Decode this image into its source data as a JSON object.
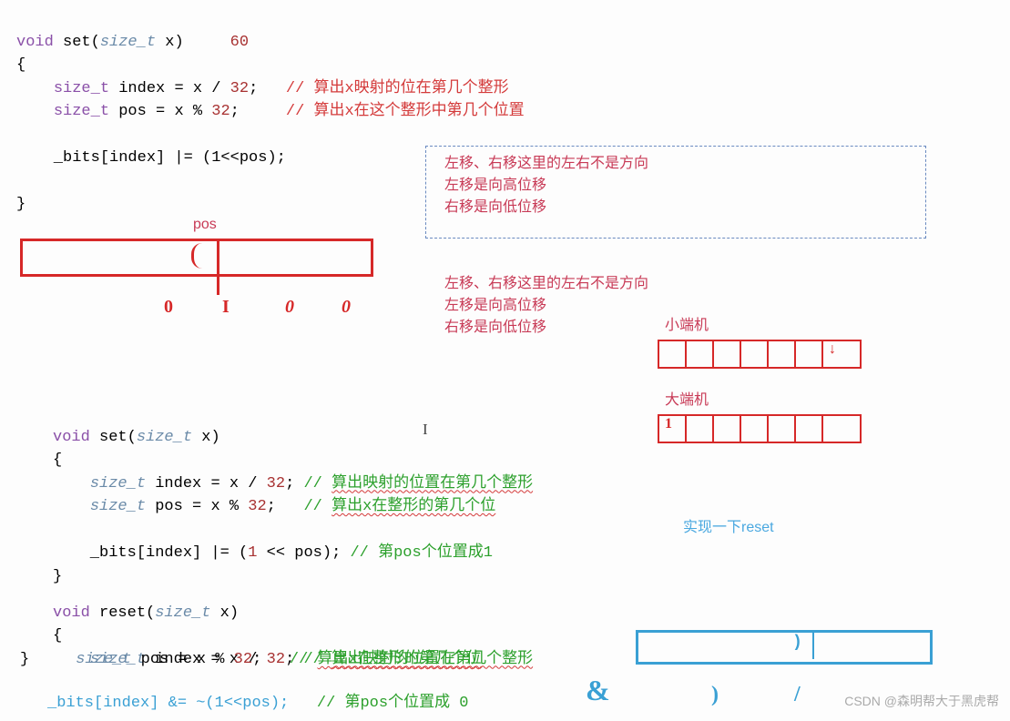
{
  "code1": {
    "l1a": "void",
    "l1b": " set(",
    "l1c": "size_t",
    "l1d": " x)",
    "anno60": "60",
    "l2": "{",
    "l3a": "    ",
    "l3b": "size_t",
    "l3c": " index = x / ",
    "l3d": "32",
    "l3e": ";   ",
    "l3f": "// 算出x映射的位在第几个整形",
    "l4a": "    ",
    "l4b": "size_t",
    "l4c": " pos = x % ",
    "l4d": "32",
    "l4e": ";     ",
    "l4f": "// 算出x在这个整形中第几个位置",
    "l6": "    _bits[index] |= (1<<pos);",
    "l8": "}",
    "poslabel": "pos"
  },
  "box1": {
    "l1": "左移、右移这里的左右不是方向",
    "l2": "左移是向高位移",
    "l3": "右移是向低位移"
  },
  "box2": {
    "l1": "左移、右移这里的左右不是方向",
    "l2": "左移是向高位移",
    "l3": "右移是向低位移"
  },
  "endian": {
    "little": "小端机",
    "big": "大端机"
  },
  "hint": "实现一下reset",
  "code2": {
    "l1a": "void",
    "l1b": " set(",
    "l1c": "size_t",
    "l1d": " x)",
    "l2": "{",
    "l3a": "    ",
    "l3b": "size_t",
    "l3c": " index = x / ",
    "l3d": "32",
    "l3e": "; ",
    "l3f": "// ",
    "l3g": "算出映射的位置在第几个整形",
    "l4a": "    ",
    "l4b": "size_t",
    "l4c": " pos = x % ",
    "l4d": "32",
    "l4e": ";   ",
    "l4f": "// ",
    "l4g": "算出x在整形的第几个位",
    "l6a": "    _bits[index] |= (",
    "l6b": "1",
    "l6c": " << pos); ",
    "l6d": "// 第pos个位置成1",
    "l7": "}"
  },
  "code3": {
    "l1a": "void",
    "l1b": " reset(",
    "l1c": "size_t",
    "l1d": " x)",
    "l2": "{",
    "l3a": "    ",
    "l3b": "size_t",
    "l3c": " index = x / ",
    "l3d": "32",
    "l3e": "; ",
    "l3f": "// ",
    "l3g": "算出映射的位置在第几个整形",
    "brace": "}   ",
    "l4b": "size_t",
    "l4c": " pos = x % ",
    "l4d": "32",
    "l4e": ";   ",
    "l4f": "// ",
    "l4g": "算出x在整形的第几个位",
    "l6a": "_bits[index] &= ~(",
    "l6b": "1",
    "l6c": "<<pos);   ",
    "l6d": "// 第pos个位置成 ",
    "l6e": "0"
  },
  "hand": {
    "d0": "0",
    "d1": "I",
    "d2": "0",
    "d3": "0",
    "amp": "&"
  },
  "watermark": "CSDN @森明帮大于黑虎帮"
}
